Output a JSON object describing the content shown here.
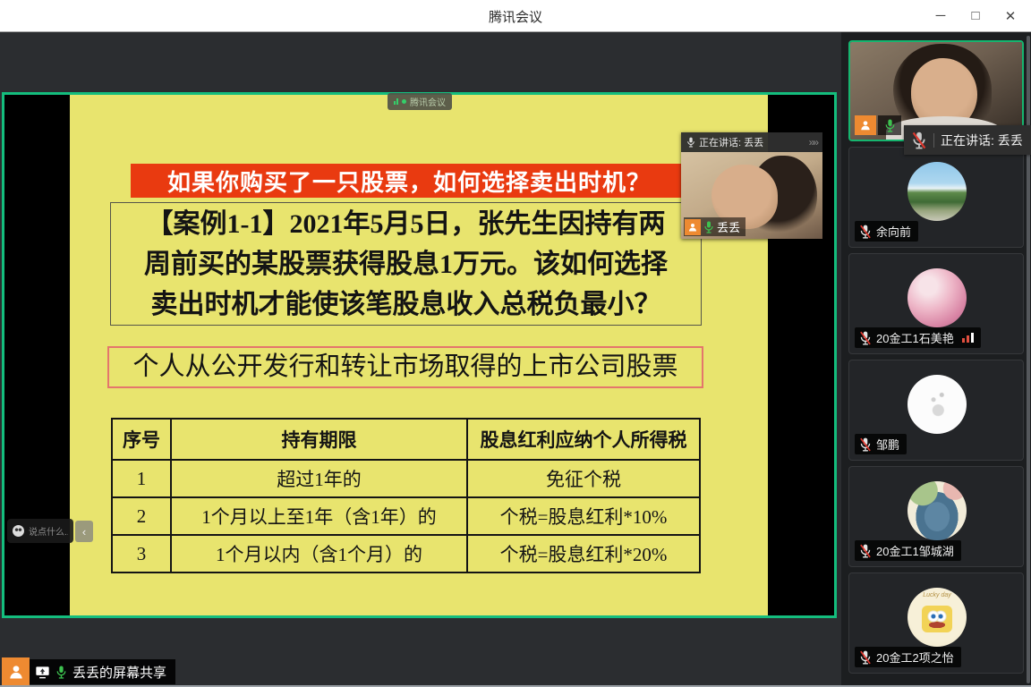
{
  "titlebar": {
    "title": "腾讯会议",
    "minimize_icon": "─",
    "maximize_icon": "□",
    "close_icon": "✕"
  },
  "share": {
    "watermark": "腾讯会议",
    "speaking_banner": "正在讲话: 丢丢",
    "speaker_label": "丢丢",
    "banner_title": "如果你购买了一只股票，如何选择卖出时机？",
    "case_lines": [
      "【案例1-1】2021年5月5日，张先生因持有两",
      "周前买的某股票获得股息1万元。该如何选择",
      "卖出时机才能使该笔股息收入总税负最小？"
    ],
    "subtitle": "个人从公开发行和转让市场取得的上市公司股票",
    "table": {
      "headers": [
        "序号",
        "持有期限",
        "股息红利应纳个人所得税"
      ],
      "rows": [
        [
          "1",
          "超过1年的",
          "免征个税"
        ],
        [
          "2",
          "1个月以上至1年（含1年）的",
          "个税=股息红利*10%"
        ],
        [
          "3",
          "1个月以内（含1个月）的",
          "个税=股息红利*20%"
        ]
      ]
    }
  },
  "chat": {
    "placeholder": "说点什么...",
    "collapse_icon": "‹"
  },
  "status_bar": {
    "screen_share_label": "丢丢的屏幕共享"
  },
  "sidebar": {
    "speaking_tooltip": "正在讲话: 丢丢",
    "participants": [
      {
        "name": "丢丢",
        "muted": false,
        "speaking": true
      },
      {
        "name": "余向前",
        "muted": true
      },
      {
        "name": "20金工1石美艳",
        "muted": true,
        "network_warning": true
      },
      {
        "name": "邹鹏",
        "muted": true
      },
      {
        "name": "20金工1邹城湖",
        "muted": true
      },
      {
        "name": "20金工2项之怡",
        "muted": true,
        "avatar_text": "Lucky day"
      }
    ]
  },
  "colors": {
    "accent_green": "#14bd7d",
    "slide_yellow": "#e8e46e",
    "banner_red": "#e93a10",
    "mic_green": "#3dc24f",
    "muted_red": "#dd372d",
    "share_orange": "#ee8a31"
  }
}
